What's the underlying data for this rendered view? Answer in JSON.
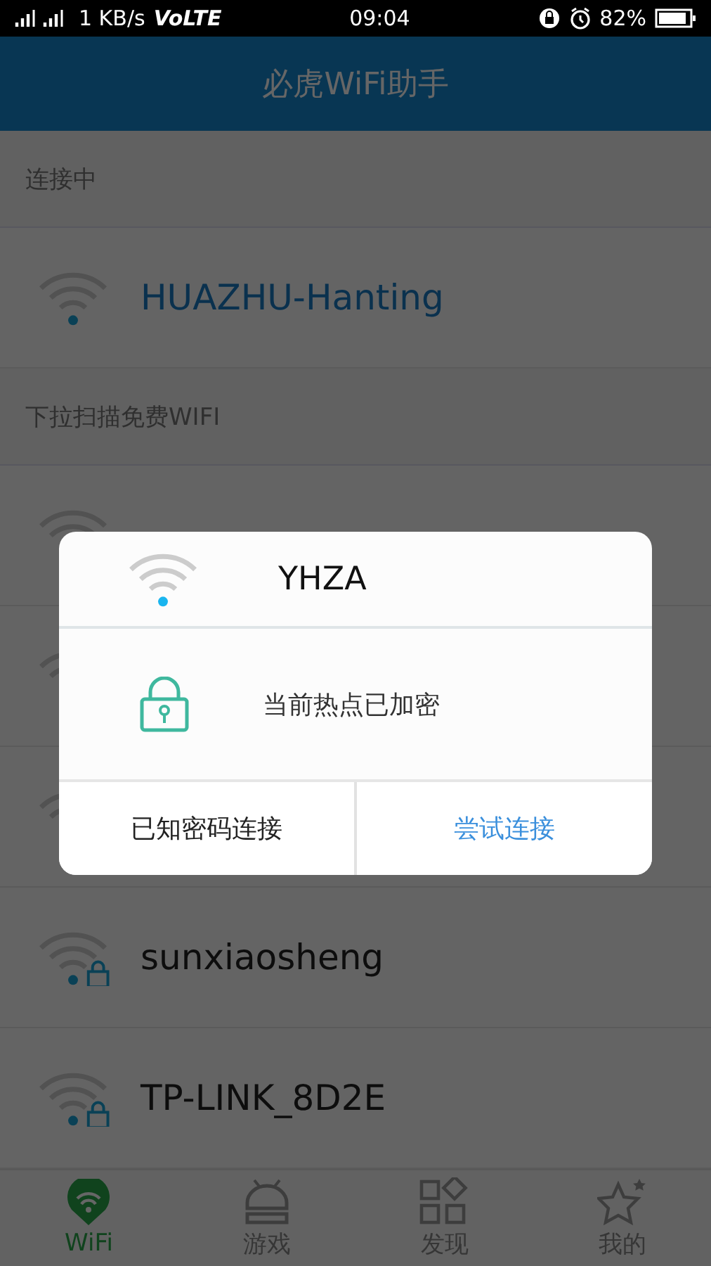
{
  "status_bar": {
    "network": "1 KB/s",
    "volte": "VoLTE",
    "time": "09:04",
    "battery": "82%"
  },
  "app_bar": {
    "title": "必虎WiFi助手"
  },
  "connected": {
    "header": "连接中",
    "network": {
      "name": "HUAZHU-Hanting",
      "locked": false
    }
  },
  "scan": {
    "header": "下拉扫描免费WIFI",
    "networks": [
      {
        "kind": "covered"
      },
      {
        "kind": "covered"
      },
      {
        "kind": "covered"
      },
      {
        "kind": "named",
        "name": "sunxiaosheng",
        "locked": true
      },
      {
        "kind": "named",
        "name": "TP-LINK_8D2E",
        "locked": true
      }
    ]
  },
  "tabs": [
    {
      "label": "WiFi",
      "kind": "wifi",
      "selected": true
    },
    {
      "label": "游戏",
      "kind": "robot",
      "selected": false
    },
    {
      "label": "发现",
      "kind": "grid",
      "selected": false
    },
    {
      "label": "我的",
      "kind": "star",
      "selected": false
    }
  ],
  "dialog": {
    "title": "YHZA",
    "message": "当前热点已加密",
    "buttons": [
      {
        "label": "已知密码连接",
        "primary": false
      },
      {
        "label": "尝试连接",
        "primary": true
      }
    ]
  }
}
